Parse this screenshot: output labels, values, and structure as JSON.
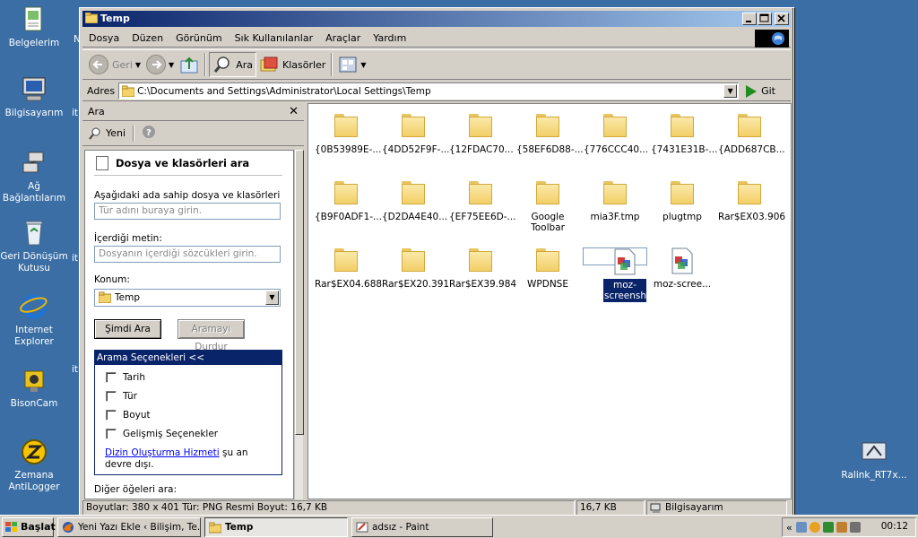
{
  "desktop": {
    "icons": [
      {
        "label": "Belgelerim"
      },
      {
        "label": "Bilgisayarım"
      },
      {
        "label": "Ağ Bağlantılarım"
      },
      {
        "label": "Geri Dönüşüm Kutusu"
      },
      {
        "label": "Internet Explorer"
      },
      {
        "label": "BisonCam"
      },
      {
        "label": "Zemana AntiLogger"
      },
      {
        "label": "Ralink_RT7x..."
      }
    ],
    "peek_labels": [
      "N",
      "it",
      "it",
      "it"
    ]
  },
  "window": {
    "title": "Temp",
    "menu": [
      "Dosya",
      "Düzen",
      "Görünüm",
      "Sık Kullanılanlar",
      "Araçlar",
      "Yardım"
    ],
    "toolbar": {
      "back": "Geri",
      "search": "Ara",
      "folders": "Klasörler"
    },
    "address": {
      "label": "Adres",
      "value": "C:\\Documents and Settings\\Administrator\\Local Settings\\Temp",
      "go": "Git"
    }
  },
  "search_pane": {
    "header": "Ara",
    "new_label": "Yeni",
    "title": "Dosya ve klasörleri ara",
    "name_label": "Aşağıdaki ada sahip dosya ve klasörleri ara:",
    "name_placeholder": "Tür adını buraya girin.",
    "content_label": "İçerdiği metin:",
    "content_placeholder": "Dosyanın içerdiği sözcükleri girin.",
    "location_label": "Konum:",
    "location_value": "Temp",
    "search_now": "Şimdi Ara",
    "stop_search": "Aramayı Durdur",
    "options_header": "Arama Seçenekleri  <<",
    "options": [
      "Tarih",
      "Tür",
      "Boyut",
      "Gelişmiş Seçenekler"
    ],
    "index_link": "Dizin Oluşturma Hizmeti",
    "index_note": " şu an devre dışı.",
    "other_label": "Diğer öğeleri ara:"
  },
  "files": [
    {
      "name": "{0B53989E-...",
      "type": "folder"
    },
    {
      "name": "{4DD52F9F-...",
      "type": "folder"
    },
    {
      "name": "{12FDAC70...",
      "type": "folder"
    },
    {
      "name": "{58EF6D88-...",
      "type": "folder"
    },
    {
      "name": "{776CCC40...",
      "type": "folder"
    },
    {
      "name": "{7431E31B-...",
      "type": "folder"
    },
    {
      "name": "{ADD687CB...",
      "type": "folder"
    },
    {
      "name": "{B9F0ADF1-...",
      "type": "folder"
    },
    {
      "name": "{D2DA4E40...",
      "type": "folder"
    },
    {
      "name": "{EF75EE6D-...",
      "type": "folder"
    },
    {
      "name": "Google Toolbar",
      "type": "folder"
    },
    {
      "name": "mia3F.tmp",
      "type": "folder"
    },
    {
      "name": "plugtmp",
      "type": "folder"
    },
    {
      "name": "Rar$EX03.906",
      "type": "folder"
    },
    {
      "name": "Rar$EX04.688",
      "type": "folder"
    },
    {
      "name": "Rar$EX20.391",
      "type": "folder"
    },
    {
      "name": "Rar$EX39.984",
      "type": "folder"
    },
    {
      "name": "WPDNSE",
      "type": "folder"
    },
    {
      "name": "moz-screenshot",
      "type": "png",
      "selected": true
    },
    {
      "name": "moz-scree...",
      "type": "png"
    }
  ],
  "status": {
    "info": "Boyutlar: 380 x 401 Tür: PNG Resmi Boyut: 16,7 KB",
    "size": "16,7 KB",
    "location": "Bilgisayarım"
  },
  "taskbar": {
    "start": "Başlat",
    "tasks": [
      {
        "label": "Yeni Yazı Ekle ‹ Bilişim, Te..."
      },
      {
        "label": "Temp",
        "active": true
      },
      {
        "label": "adsız - Paint"
      }
    ],
    "clock": "00:12"
  },
  "colors": {
    "desktop": "#3a6ea5",
    "titlebar": "#0a246a",
    "selection": "#0a246a",
    "window": "#d4d0c8"
  }
}
